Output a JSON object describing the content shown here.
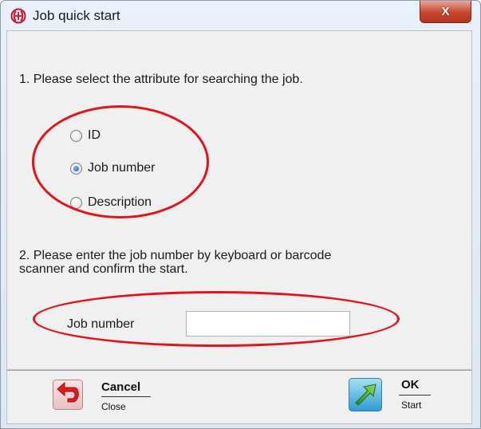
{
  "window": {
    "title": "Job quick start",
    "close_label": "X"
  },
  "step1": {
    "text": "1. Please select the attribute for searching the job.",
    "options": [
      {
        "label": "ID",
        "checked": false
      },
      {
        "label": "Job number",
        "checked": true
      },
      {
        "label": "Description",
        "checked": false
      }
    ]
  },
  "step2": {
    "text_line1": "2. Please enter the job number by keyboard or barcode",
    "text_line2": "scanner and confirm the start.",
    "field_label": "Job number",
    "field_value": ""
  },
  "footer": {
    "cancel": {
      "title": "Cancel",
      "subtitle": "Close"
    },
    "ok": {
      "title": "OK",
      "subtitle": "Start"
    }
  },
  "colors": {
    "highlight": "#e1141c",
    "accent": "#1c5fb8"
  }
}
